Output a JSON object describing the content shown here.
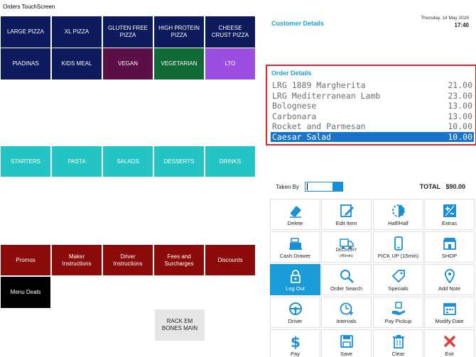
{
  "window": {
    "title": "Orders TouchScreen"
  },
  "categories_row1": [
    {
      "label": "LARGE PIZZA",
      "color": "#0d1a5c"
    },
    {
      "label": "XL PIZZA",
      "color": "#0d1a5c"
    },
    {
      "label": "GLUTEN FREE\nPIZZA",
      "color": "#0d1a5c"
    },
    {
      "label": "HIGH PROTEIN\nPIZZA",
      "color": "#0d1a5c"
    },
    {
      "label": "CHEESE\nCRUST PIZZA",
      "color": "#0d1a5c"
    }
  ],
  "categories_row2": [
    {
      "label": "PIADINAS",
      "color": "#0d1a5c"
    },
    {
      "label": "KIDS MEAL",
      "color": "#0d1a5c"
    },
    {
      "label": "VEGAN",
      "color": "#5c0f45"
    },
    {
      "label": "VEGETARIAN",
      "color": "#0f6a36"
    },
    {
      "label": "LTO",
      "color": "#9b4fe0"
    }
  ],
  "categories_row3": [
    {
      "label": "STARTERS",
      "color": "#25c4c4"
    },
    {
      "label": "PASTA",
      "color": "#25c4c4"
    },
    {
      "label": "SALADS",
      "color": "#25c4c4"
    },
    {
      "label": "DESSERTS",
      "color": "#25c4c4"
    },
    {
      "label": "DRINKS",
      "color": "#25c4c4"
    }
  ],
  "categories_row4": [
    {
      "label": "Promos",
      "color": "#8b0a0a"
    },
    {
      "label": "Maker\nInstructions",
      "color": "#8b0a0a"
    },
    {
      "label": "Driver\nInstructions",
      "color": "#8b0a0a"
    },
    {
      "label": "Fees and\nSurcharges",
      "color": "#8b0a0a"
    },
    {
      "label": "Discounts",
      "color": "#8b0a0a"
    }
  ],
  "menu_deals": {
    "label": "Menu Deals",
    "color": "#000000"
  },
  "rack_em": {
    "label": "RACK EM\nBONES MAIN",
    "color": "#e6e6e6"
  },
  "customer": {
    "title": "Customer Details",
    "date": "Thursday, 14 May 2026",
    "time": "17:40"
  },
  "order": {
    "title": "Order Details",
    "lines": [
      {
        "name": "LRG 1889 Margherita",
        "price": "21.00",
        "selected": false
      },
      {
        "name": "LRG Mediterranean Lamb",
        "price": "23.00",
        "selected": false
      },
      {
        "name": "Bolognese",
        "price": "13.00",
        "selected": false
      },
      {
        "name": "Carbonara",
        "price": "13.00",
        "selected": false
      },
      {
        "name": "Rocket and Parmesan",
        "price": "10.00",
        "selected": false
      },
      {
        "name": "Caesar Salad",
        "price": "10.00",
        "selected": true
      }
    ]
  },
  "taken_by": {
    "label": "Taken By",
    "value": ""
  },
  "total": {
    "label": "TOTAL",
    "value": "$90.00"
  },
  "actions": [
    {
      "label": "Delete",
      "sub": "",
      "icon": "eraser-icon",
      "active": false
    },
    {
      "label": "Edit Item",
      "sub": "",
      "icon": "edit-icon",
      "active": false
    },
    {
      "label": "Half/Half",
      "sub": "",
      "icon": "half-circle-icon",
      "active": false
    },
    {
      "label": "Extras",
      "sub": "",
      "icon": "plus-minus-icon",
      "active": false
    },
    {
      "label": "Cash Drawer",
      "sub": "",
      "icon": "cash-register-icon",
      "active": false
    },
    {
      "label": "DELIVERY",
      "sub": "(45min)",
      "icon": "delivery-truck-icon",
      "active": false
    },
    {
      "label": "PICK UP (15min)",
      "sub": "",
      "icon": "phone-icon",
      "active": false
    },
    {
      "label": "SHOP",
      "sub": "",
      "icon": "shop-icon",
      "active": false
    },
    {
      "label": "Log Out",
      "sub": "",
      "icon": "lock-icon",
      "active": true
    },
    {
      "label": "Order Search",
      "sub": "",
      "icon": "search-icon",
      "active": false
    },
    {
      "label": "Specials",
      "sub": "",
      "icon": "tag-icon",
      "active": false
    },
    {
      "label": "Add Note",
      "sub": "",
      "icon": "pin-icon",
      "active": false
    },
    {
      "label": "Driver",
      "sub": "",
      "icon": "steering-wheel-icon",
      "active": false
    },
    {
      "label": "Intervals",
      "sub": "",
      "icon": "clock-plus-icon",
      "active": false
    },
    {
      "label": "Pay Pickup",
      "sub": "",
      "icon": "hand-money-icon",
      "active": false
    },
    {
      "label": "Modify Date",
      "sub": "",
      "icon": "calendar-icon",
      "active": false
    },
    {
      "label": "Pay",
      "sub": "",
      "icon": "dollar-icon",
      "active": false
    },
    {
      "label": "Save",
      "sub": "",
      "icon": "save-icon",
      "active": false
    },
    {
      "label": "Clear",
      "sub": "",
      "icon": "trash-icon",
      "active": false
    },
    {
      "label": "Exit",
      "sub": "",
      "icon": "close-icon",
      "active": false
    }
  ],
  "colors": {
    "accent": "#1e9fcf",
    "icon_blue": "#1a8fd8",
    "selected_row": "#1a73c8",
    "highlight_border": "#d9262a",
    "exit_red": "#e03c3c"
  }
}
